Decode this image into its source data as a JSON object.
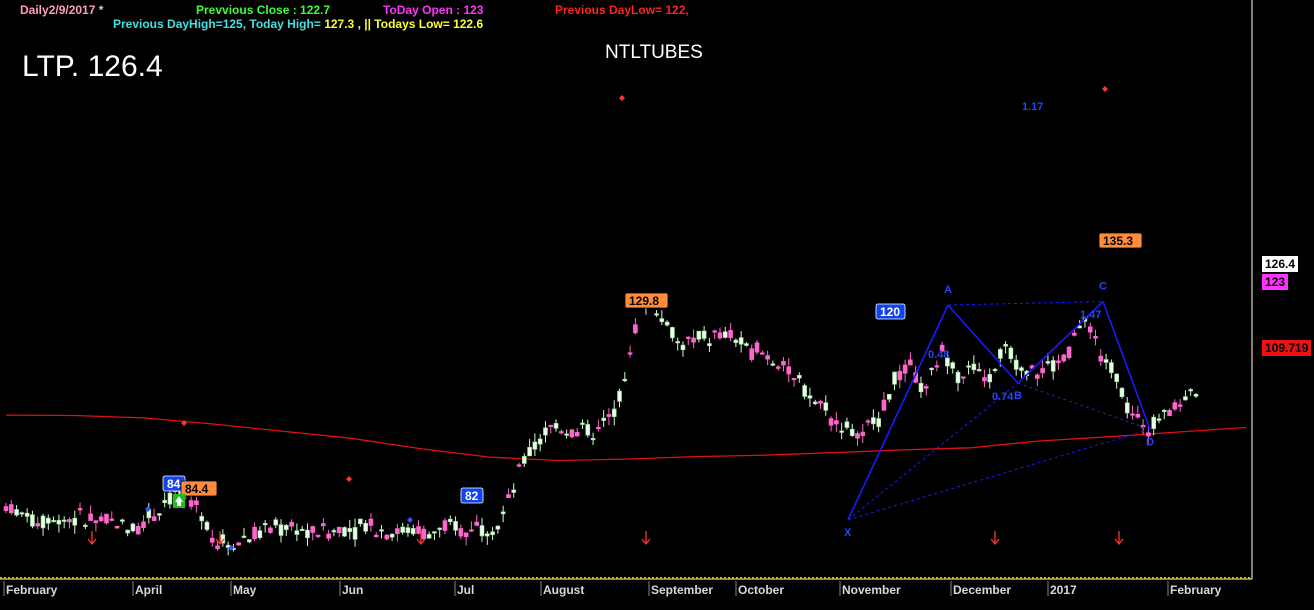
{
  "header": {
    "daily_label": "Daily",
    "date": "2/9/2017",
    "asterisk": "*",
    "previous_close": "Prevvious Close : 122.7",
    "today_open": "ToDay Open : 123",
    "previous_day_low": "Previous DayLow=   122,",
    "previous_day_high": "Previous DayHigh=125, Today High=",
    "today_high_value": "127.3",
    "sep": ", ||",
    "todays_low": "Todays Low= 122.6"
  },
  "ltp": "LTP. 126.4",
  "symbol": "NTLTUBES",
  "price_tags": {
    "last": "126.4",
    "open": "123",
    "ma": "109.719"
  },
  "colors": {
    "background": "#000000",
    "up_candle": "#ccffcc",
    "down_candle": "#ff66cc",
    "ma_line": "#dd1111",
    "pattern": "#1a1aff",
    "label_orange": "#ff8c3a",
    "label_blue": "#1144ee"
  },
  "chart_data": {
    "type": "line",
    "title": "NTLTUBES",
    "x_axis_labels": [
      "February",
      "April",
      "May",
      "Jun",
      "Jul",
      "August",
      "September",
      "October",
      "November",
      "December",
      "2017",
      "February"
    ],
    "series": [
      {
        "name": "Close",
        "values": [
          92,
          90,
          88,
          89,
          89,
          89,
          88,
          87,
          87,
          89,
          94,
          96,
          92,
          84,
          81,
          83,
          85,
          86,
          86,
          85,
          86,
          86,
          86,
          87,
          86,
          85,
          85,
          85,
          86,
          86,
          87,
          88,
          98,
          108,
          113,
          115,
          114,
          113,
          117,
          128,
          150,
          149,
          140,
          138,
          140,
          140,
          139,
          137,
          134,
          132,
          127,
          123,
          118,
          114,
          112,
          118,
          128,
          132,
          125,
          136,
          130,
          132,
          128,
          137,
          132,
          131,
          131,
          137,
          145,
          135,
          128,
          117,
          115,
          119,
          122,
          126
        ]
      },
      {
        "name": "Moving Average",
        "values": [
          118,
          117.9,
          117.2,
          115.5,
          113.5,
          111.5,
          108.6,
          106.2,
          105.2,
          105.6,
          106.3,
          106.7,
          107.4,
          108.2,
          108.8,
          110.7,
          111.9,
          113.2,
          114.5
        ]
      }
    ],
    "labels": [
      {
        "text": "84",
        "style": "blue"
      },
      {
        "text": "84.4",
        "style": "orange"
      },
      {
        "text": "82",
        "style": "blue"
      },
      {
        "text": "129.8",
        "style": "orange"
      },
      {
        "text": "120",
        "style": "blue"
      },
      {
        "text": "135.3",
        "style": "orange"
      }
    ],
    "pattern": {
      "points": [
        "X",
        "A",
        "B",
        "C",
        "D"
      ],
      "ratios": [
        "1.17",
        "0.48",
        "1.47",
        "0.74"
      ]
    },
    "grid": false
  }
}
